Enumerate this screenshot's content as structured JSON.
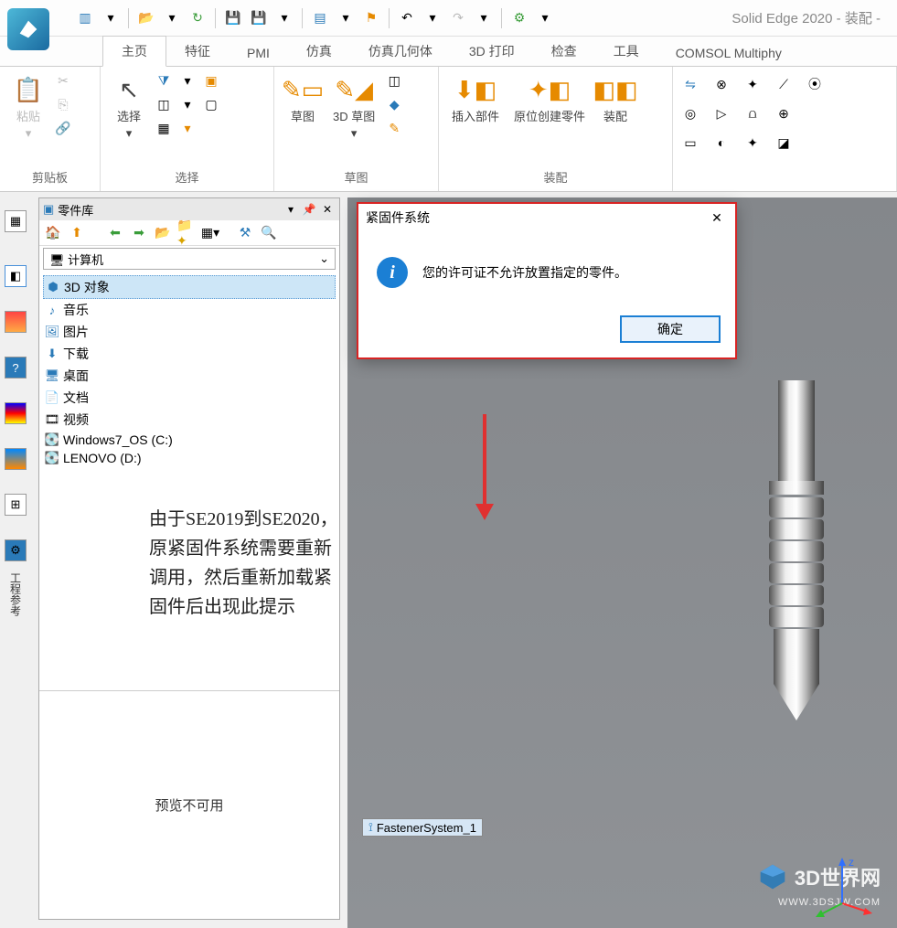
{
  "app": {
    "title": "Solid Edge 2020 - 装配 -"
  },
  "tabs": [
    "主页",
    "特征",
    "PMI",
    "仿真",
    "仿真几何体",
    "3D 打印",
    "检查",
    "工具",
    "COMSOL Multiphy"
  ],
  "active_tab": "主页",
  "ribbon": {
    "groups": [
      {
        "label": "剪贴板",
        "items": [
          {
            "label": "粘贴"
          }
        ]
      },
      {
        "label": "选择",
        "items": [
          {
            "label": "选择"
          }
        ]
      },
      {
        "label": "草图",
        "items": [
          {
            "label": "草图"
          },
          {
            "label": "3D 草图"
          }
        ]
      },
      {
        "label": "",
        "items": [
          {
            "label": "插入部件"
          },
          {
            "label": "原位创建零件"
          },
          {
            "label": "装配"
          }
        ]
      },
      {
        "label": "装配"
      }
    ]
  },
  "parts_panel": {
    "title": "零件库",
    "combo": "计算机",
    "tree": [
      {
        "icon": "cube",
        "label": "3D 对象",
        "selected": true
      },
      {
        "icon": "music",
        "label": "音乐"
      },
      {
        "icon": "image",
        "label": "图片"
      },
      {
        "icon": "download",
        "label": "下载"
      },
      {
        "icon": "desktop",
        "label": "桌面"
      },
      {
        "icon": "doc",
        "label": "文档"
      },
      {
        "icon": "video",
        "label": "视频"
      },
      {
        "icon": "drive",
        "label": "Windows7_OS (C:)"
      },
      {
        "icon": "drive",
        "label": "LENOVO (D:)"
      }
    ],
    "annotation": "由于SE2019到SE2020，原紧固件系统需要重新调用，然后重新加载紧固件后出现此提示",
    "preview": "预览不可用"
  },
  "dialog": {
    "title": "紧固件系统",
    "message": "您的许可证不允许放置指定的零件。",
    "ok": "确定"
  },
  "viewport": {
    "item_label": "FastenerSystem_1",
    "axis_z": "z"
  },
  "watermark": {
    "text": "3D世界网",
    "sub": "WWW.3DSJW.COM"
  },
  "rail_label": "工程参考"
}
